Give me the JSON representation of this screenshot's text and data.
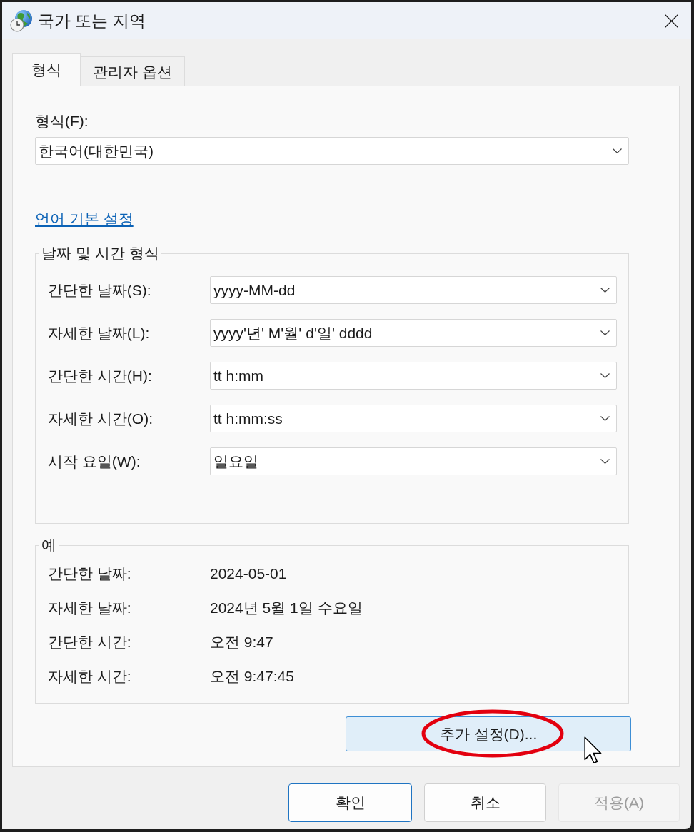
{
  "window": {
    "title": "국가 또는 지역"
  },
  "tabs": [
    {
      "label": "형식",
      "selected": true
    },
    {
      "label": "관리자 옵션",
      "selected": false
    }
  ],
  "format": {
    "label": "형식(F):",
    "value": "한국어(대한민국)"
  },
  "language_link": "언어 기본 설정",
  "date_time_formats": {
    "title": "날짜 및 시간 형식",
    "rows": [
      {
        "label": "간단한 날짜(S):",
        "value": "yyyy-MM-dd"
      },
      {
        "label": "자세한 날짜(L):",
        "value": "yyyy'년' M'월' d'일' dddd"
      },
      {
        "label": "간단한 시간(H):",
        "value": "tt h:mm"
      },
      {
        "label": "자세한 시간(O):",
        "value": "tt h:mm:ss"
      },
      {
        "label": "시작 요일(W):",
        "value": "일요일"
      }
    ]
  },
  "examples": {
    "title": "예",
    "rows": [
      {
        "label": "간단한 날짜:",
        "value": "2024-05-01"
      },
      {
        "label": "자세한 날짜:",
        "value": "2024년 5월 1일 수요일"
      },
      {
        "label": "간단한 시간:",
        "value": "오전 9:47"
      },
      {
        "label": "자세한 시간:",
        "value": "오전 9:47:45"
      }
    ]
  },
  "additional_settings_button": {
    "label": "추가 설정(D)...",
    "hovered": true,
    "highlighted": true
  },
  "buttons": [
    {
      "label": "확인",
      "default": true,
      "disabled": false
    },
    {
      "label": "취소",
      "default": false,
      "disabled": false
    },
    {
      "label": "적용(A)",
      "default": false,
      "disabled": true
    }
  ]
}
